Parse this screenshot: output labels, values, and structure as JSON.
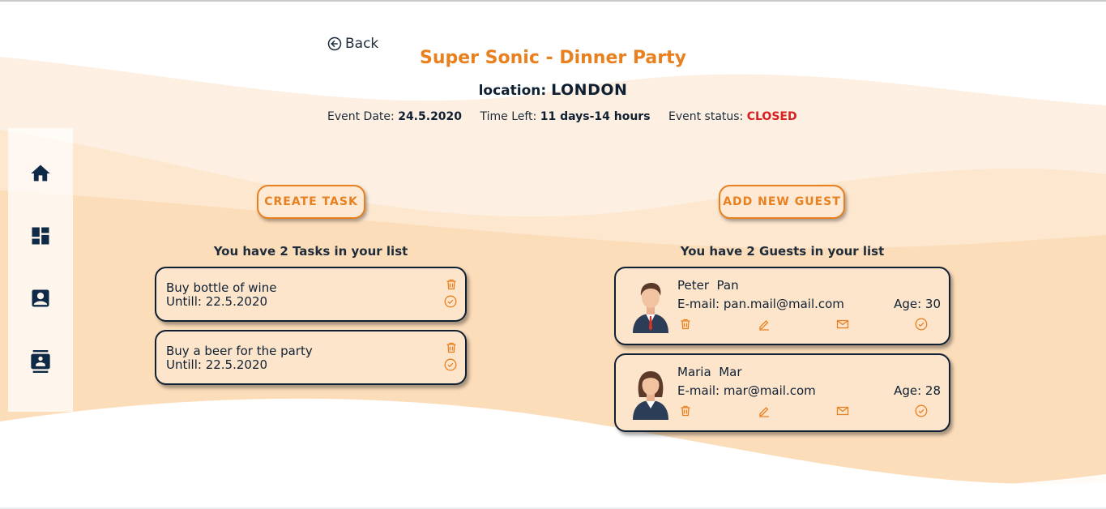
{
  "event": {
    "back_label": "Back",
    "title": "Super Sonic - Dinner Party",
    "location_label": "location:",
    "location_value": "LONDON",
    "date_label": "Event Date:",
    "date_value": "24.5.2020",
    "time_left_label": "Time Left:",
    "time_left_value": "11 days-14 hours",
    "status_label": "Event status:",
    "status_value": "CLOSED"
  },
  "colors": {
    "accent": "#e8801f",
    "navy": "#0f2033",
    "status_closed": "#d62020",
    "card_bg": "#fde5cc"
  },
  "sidebar": {
    "items": [
      {
        "icon": "home-icon"
      },
      {
        "icon": "dashboard-icon"
      },
      {
        "icon": "contact-icon"
      },
      {
        "icon": "contacts-book-icon"
      }
    ]
  },
  "tasks": {
    "button_label": "CREATE TASK",
    "heading": "You have 2 Tasks in your list",
    "items": [
      {
        "title": "Buy bottle of wine",
        "until": "Untill: 22.5.2020"
      },
      {
        "title": "Buy a beer for the party",
        "until": "Untill: 22.5.2020"
      }
    ]
  },
  "guests": {
    "button_label": "ADD NEW GUEST",
    "heading": "You have 2 Guests in your list",
    "items": [
      {
        "name": "Peter  Pan",
        "email": "E-mail: pan.mail@mail.com",
        "age": "Age: 30",
        "avatar": "male-avatar"
      },
      {
        "name": "Maria  Mar",
        "email": "E-mail: mar@mail.com",
        "age": "Age: 28",
        "avatar": "female-avatar"
      }
    ]
  }
}
